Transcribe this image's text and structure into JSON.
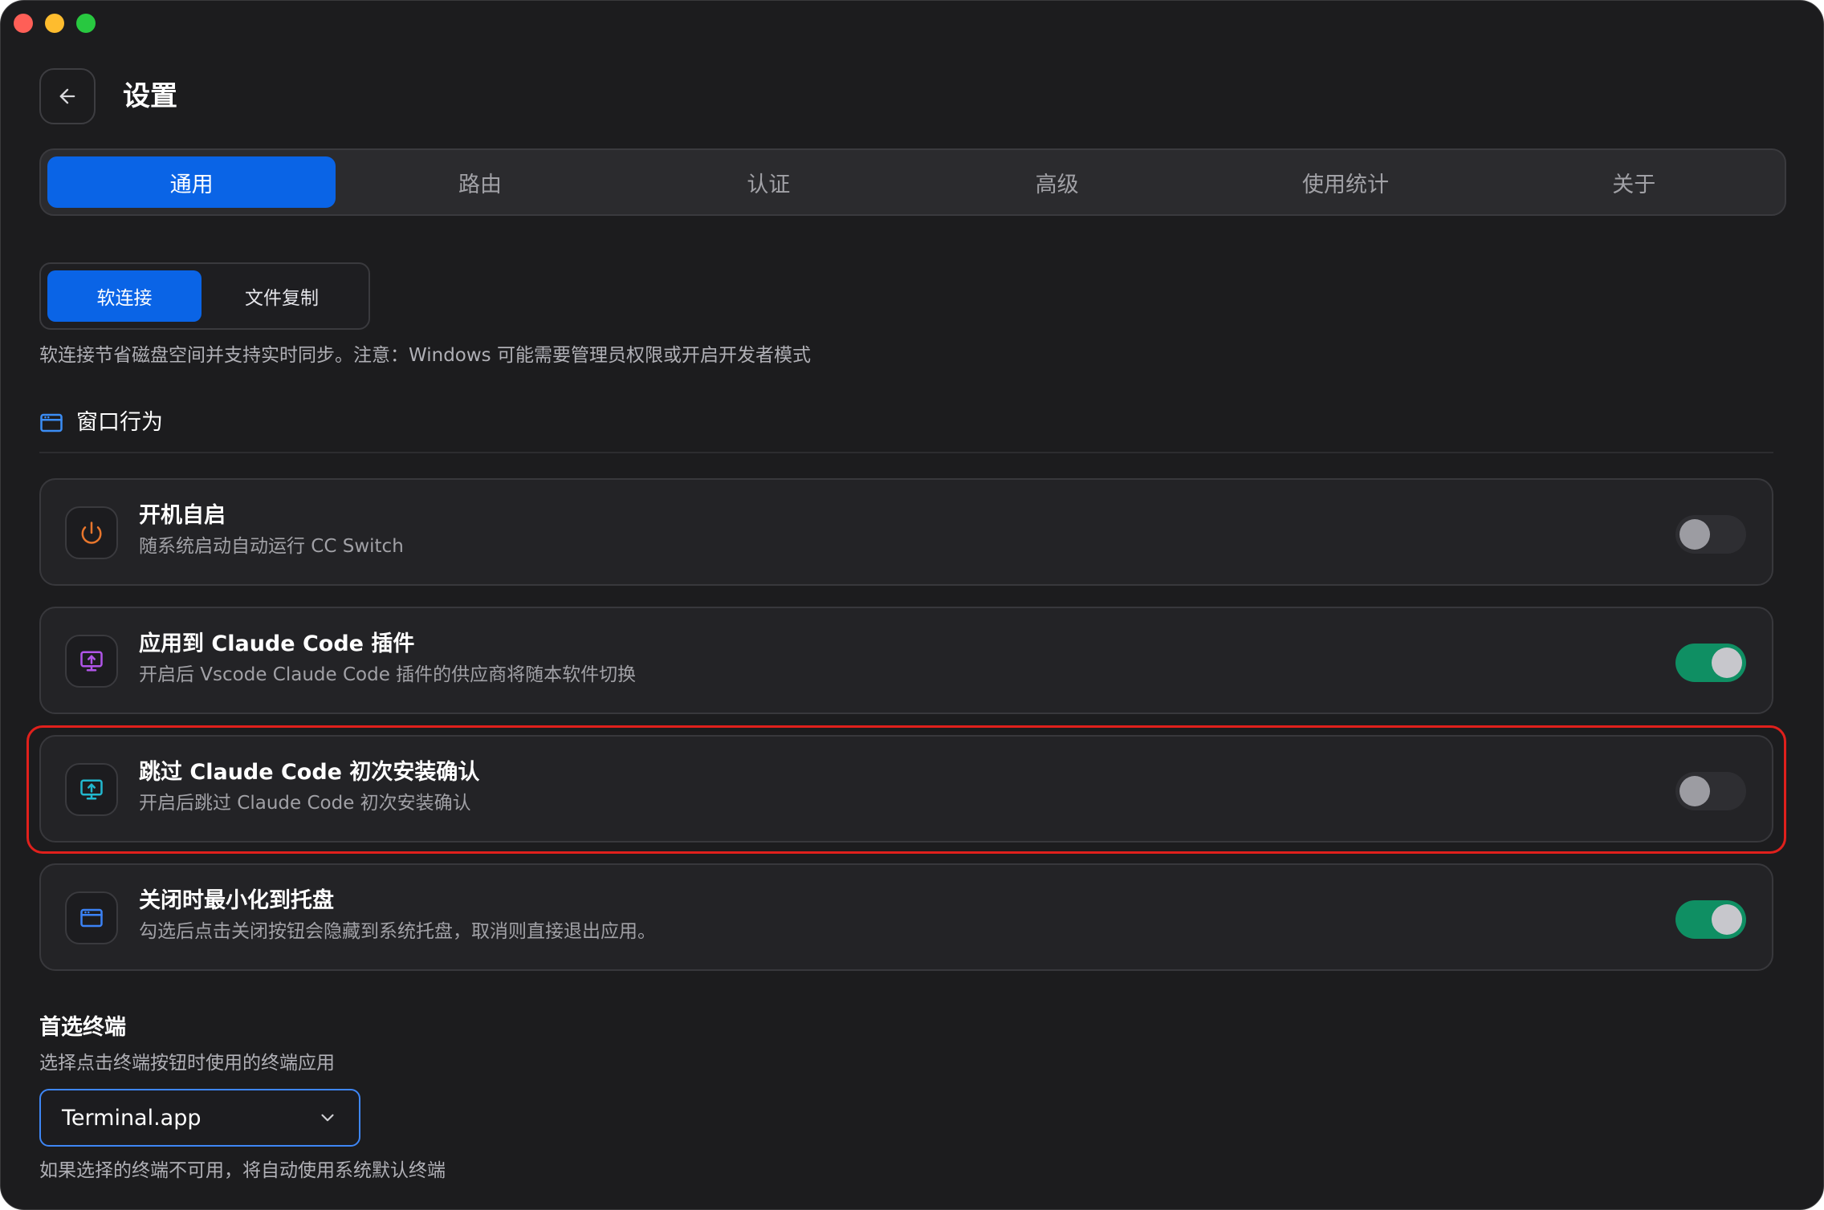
{
  "window": {
    "controls": [
      "close",
      "minimize",
      "zoom"
    ]
  },
  "header": {
    "back_icon": "arrow-left-icon",
    "title": "设置"
  },
  "tabs": [
    {
      "label": "通用",
      "active": true
    },
    {
      "label": "路由",
      "active": false
    },
    {
      "label": "认证",
      "active": false
    },
    {
      "label": "高级",
      "active": false
    },
    {
      "label": "使用统计",
      "active": false
    },
    {
      "label": "关于",
      "active": false
    }
  ],
  "sync_mode": {
    "options": [
      {
        "label": "软连接",
        "active": true
      },
      {
        "label": "文件复制",
        "active": false
      }
    ],
    "hint": "软连接节省磁盘空间并支持实时同步。注意：Windows 可能需要管理员权限或开启开发者模式"
  },
  "window_section": {
    "icon": "app-window-icon",
    "title": "窗口行为",
    "settings": [
      {
        "icon": "power-icon",
        "icon_color": "#e8762c",
        "title": "开机自启",
        "description": "随系统启动自动运行 CC Switch",
        "enabled": false
      },
      {
        "icon": "monitor-upload-icon",
        "icon_color": "#b055e8",
        "title": "应用到 Claude Code 插件",
        "description": "开启后 Vscode Claude Code 插件的供应商将随本软件切换",
        "enabled": true
      },
      {
        "icon": "monitor-upload-icon",
        "icon_color": "#22b8cf",
        "title": "跳过 Claude Code 初次安装确认",
        "description": "开启后跳过 Claude Code 初次安装确认",
        "enabled": false,
        "highlighted": true
      },
      {
        "icon": "app-window-icon",
        "icon_color": "#3b82f6",
        "title": "关闭时最小化到托盘",
        "description": "勾选后点击关闭按钮会隐藏到系统托盘，取消则直接退出应用。",
        "enabled": true
      }
    ]
  },
  "terminal": {
    "title": "首选终端",
    "description": "选择点击终端按钮时使用的终端应用",
    "selected": "Terminal.app",
    "dropdown_icon": "chevron-down-icon",
    "note": "如果选择的终端不可用，将自动使用系统默认终端"
  },
  "colors": {
    "accent": "#0a64e6",
    "toggle_on": "#0f8f63",
    "highlight": "#e0201c",
    "background": "#1c1c1e"
  }
}
